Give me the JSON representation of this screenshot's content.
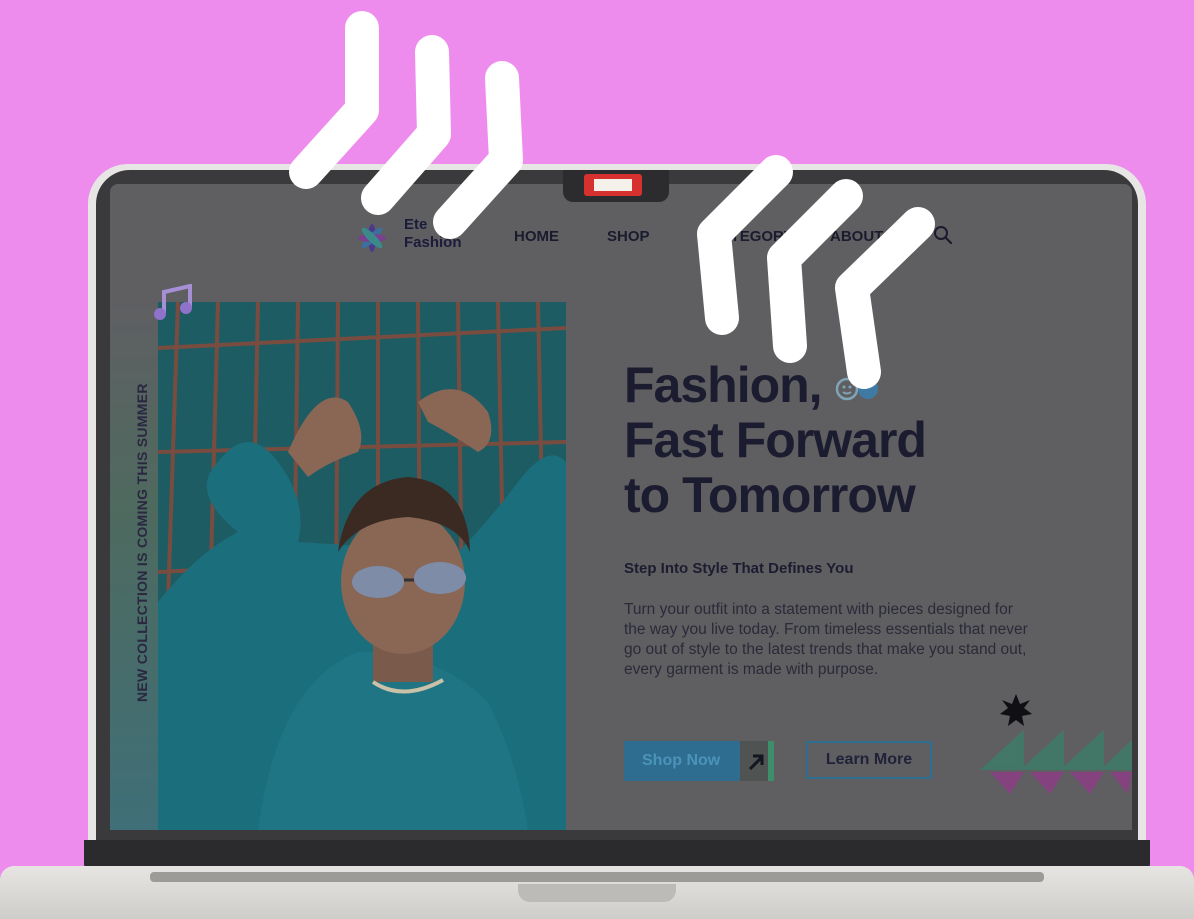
{
  "window": {
    "notch_badge": ""
  },
  "brand": {
    "line1": "Ete",
    "line2": "Fashion"
  },
  "nav": {
    "home": "HOME",
    "shop": "SHOP",
    "category": "CATEGORY",
    "about": "ABOUT"
  },
  "sidebar": {
    "vertical_text": "NEW COLLECTION IS COMING THIS SUMMER"
  },
  "hero": {
    "title_line1": "Fashion,",
    "title_line2": "Fast Forward",
    "title_line3": "to Tomorrow",
    "subtitle": "Step Into Style That Defines You",
    "body": "Turn your outfit into a statement with pieces designed for the way you live today. From timeless essentials that never go out of style to the latest trends that make you stand out, every garment is made with purpose.",
    "primary_button": "Shop Now",
    "secondary_button": "Learn More"
  },
  "icons": {
    "music": "music-note-icon",
    "search": "search-icon",
    "smiley": "smiley-pair-icon",
    "arrow": "arrow-up-right-icon",
    "burst": "starburst-icon"
  },
  "colors": {
    "background": "#ee8ced",
    "accent": "#2e6d8f",
    "title": "#1c1c30",
    "chevron": "#ffffff"
  }
}
